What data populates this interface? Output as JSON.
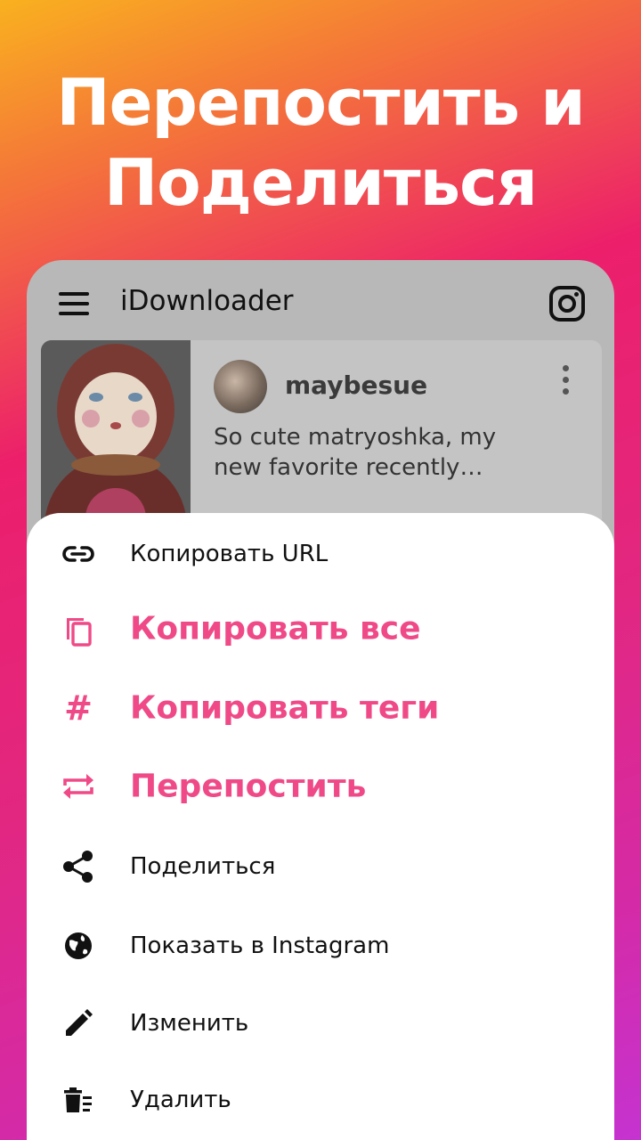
{
  "headline": {
    "line1": "Перепостить и",
    "line2": "Поделиться"
  },
  "app": {
    "title": "iDownloader",
    "menu_icon": "hamburger-menu-icon",
    "instagram_icon": "instagram-icon"
  },
  "post": {
    "username": "maybesue",
    "caption": "So cute matryoshka, my\nnew favorite recently…",
    "more_icon": "more-vert-icon"
  },
  "colors": {
    "accent": "#ef4a87",
    "gradient_top": "#f9b11f",
    "gradient_mid": "#ec1f6b",
    "gradient_bottom": "#c533d0"
  },
  "menu": {
    "items": [
      {
        "label": "Копировать URL",
        "icon": "link-icon",
        "accent": false
      },
      {
        "label": "Копировать все",
        "icon": "copy-icon",
        "accent": true
      },
      {
        "label": "Копировать теги",
        "icon": "hashtag-icon",
        "accent": true
      },
      {
        "label": "Перепостить",
        "icon": "repost-icon",
        "accent": true
      },
      {
        "label": "Поделиться",
        "icon": "share-icon",
        "accent": false
      },
      {
        "label": "Показать в Instagram",
        "icon": "globe-icon",
        "accent": false
      },
      {
        "label": "Изменить",
        "icon": "pencil-icon",
        "accent": false
      },
      {
        "label": "Удалить",
        "icon": "trash-icon",
        "accent": false
      }
    ]
  }
}
